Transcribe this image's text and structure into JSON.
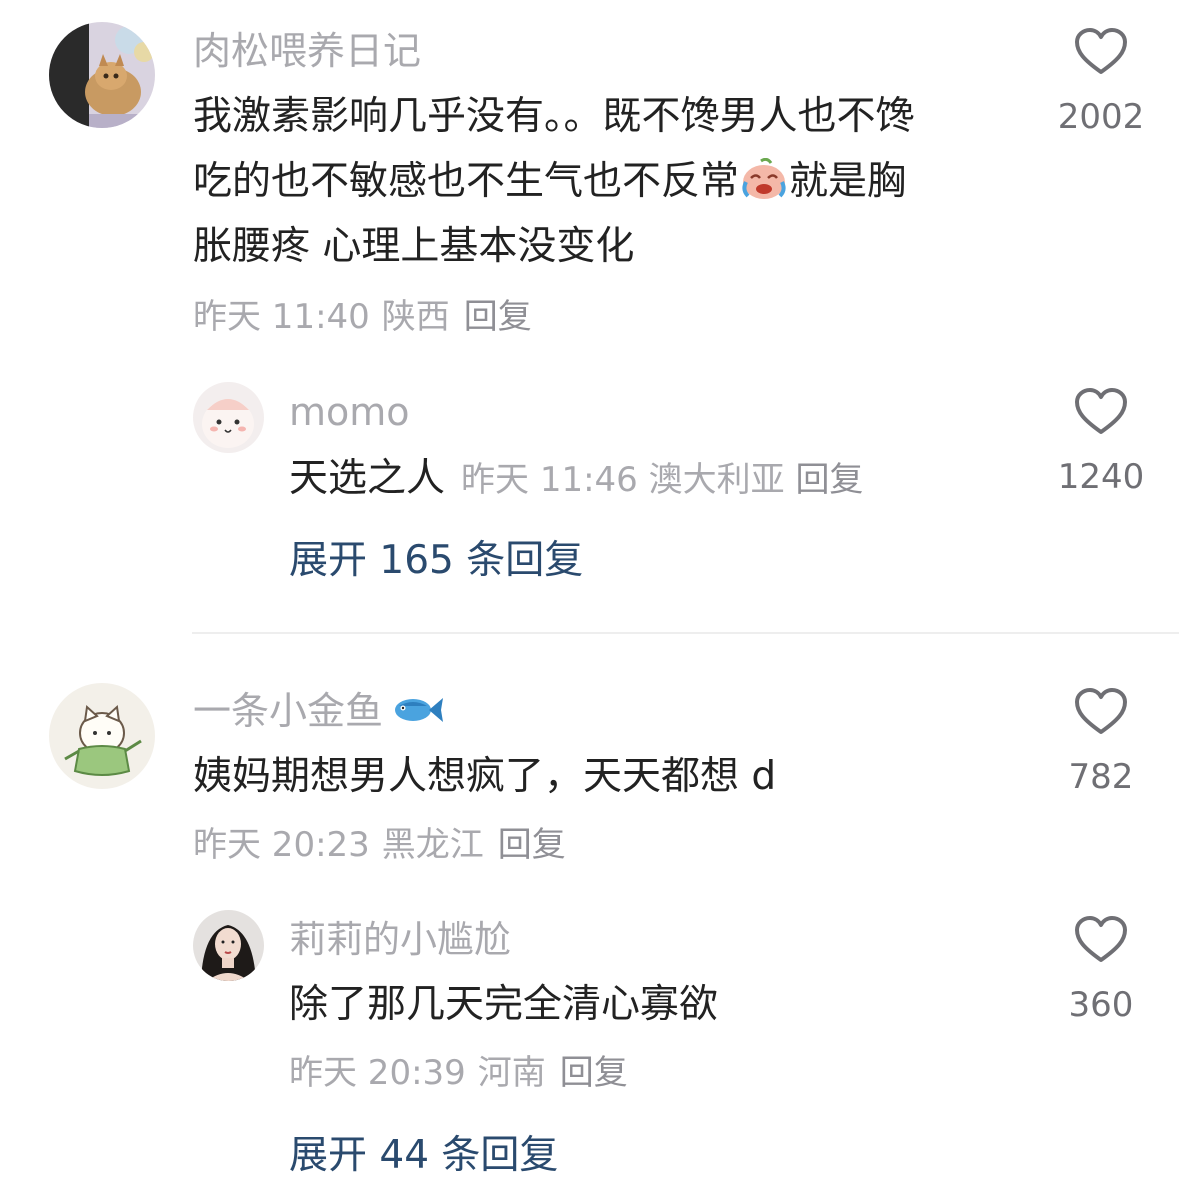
{
  "comments": [
    {
      "username": "肉松喂养日记",
      "avatar_icon": "cat-photo-avatar",
      "text_lines": [
        "我激素影响几乎没有。。既不馋男人也不馋",
        "吃的也不敏感也不生气也不反常",
        "就是胸",
        "胀腰疼 心理上基本没变化"
      ],
      "emoji_icon": "crying-laughing-emoji",
      "time": "昨天 11:40",
      "location": "陕西",
      "reply_label": "回复",
      "likes": "2002",
      "replies": [
        {
          "username": "momo",
          "avatar_icon": "cartoon-blob-avatar",
          "text": "天选之人",
          "time": "昨天 11:46",
          "location": "澳大利亚",
          "reply_label": "回复",
          "likes": "1240"
        }
      ],
      "expand_label": "展开 165 条回复"
    },
    {
      "username": "一条小金鱼",
      "username_icon": "fish-icon",
      "avatar_icon": "cartoon-cat-avatar",
      "text": "姨妈期想男人想疯了，天天都想 d",
      "time": "昨天 20:23",
      "location": "黑龙江",
      "reply_label": "回复",
      "likes": "782",
      "replies": [
        {
          "username": "莉莉的小尴尬",
          "avatar_icon": "portrait-avatar",
          "text": "除了那几天完全清心寡欲",
          "time": "昨天 20:39",
          "location": "河南",
          "reply_label": "回复",
          "likes": "360"
        }
      ],
      "expand_label": "展开 44 条回复"
    }
  ],
  "colors": {
    "text": "#222222",
    "secondary": "#a9a9ae",
    "link": "#2a4a6e",
    "heart_outline": "#6f6f74"
  }
}
